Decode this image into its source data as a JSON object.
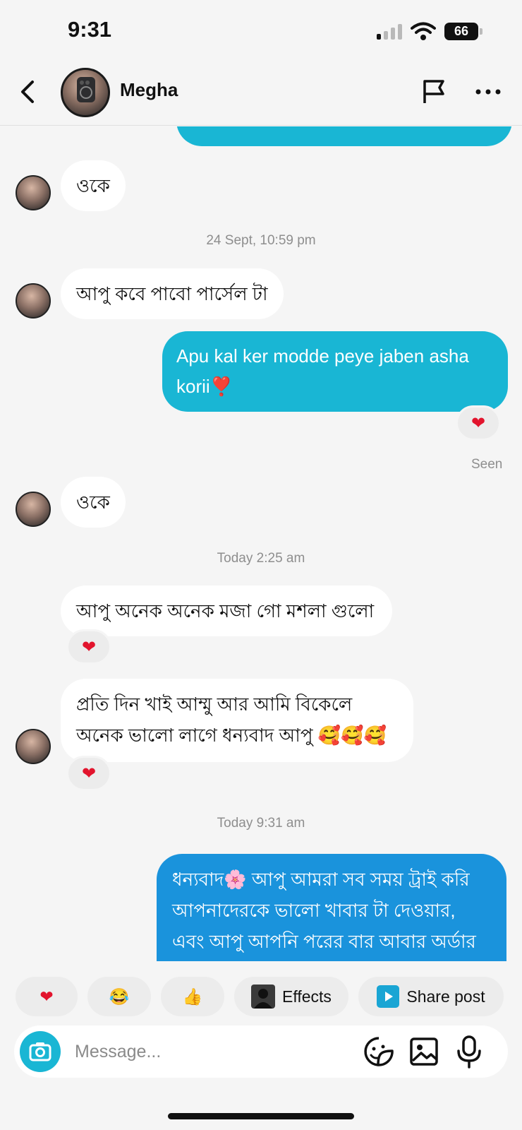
{
  "status_bar": {
    "time": "9:31",
    "battery": "66"
  },
  "header": {
    "contact_name": "Megha"
  },
  "messages": {
    "m1": {
      "text": "ওকে"
    },
    "ts1": {
      "text": "24 Sept, 10:59 pm"
    },
    "m2": {
      "text": "আপু কবে পাবো পার্সেল টা"
    },
    "m3": {
      "text": "Apu kal ker modde peye jaben asha korii❣️",
      "reaction": "❤"
    },
    "seen": {
      "text": "Seen"
    },
    "m4": {
      "text": "ওকে"
    },
    "ts2": {
      "text": "Today 2:25 am"
    },
    "m5": {
      "text": "আপু অনেক অনেক মজা গো মশলা গুলো",
      "reaction": "❤"
    },
    "m6": {
      "text": "প্রতি দিন খাই আম্মু আর আমি বিকেলে অনেক ভালো লাগে ধন্যবাদ আপু 🥰🥰🥰",
      "reaction": "❤"
    },
    "ts3": {
      "text": "Today 9:31 am"
    },
    "m7": {
      "text": "ধন্যবাদ🌸 আপু আমরা সব সময় ট্রাই করি আপনাদেরকে ভালো খাবার টা দেওয়ার, এবং আপু আপনি পরের বার আবার অর্ডার করলে"
    }
  },
  "quick_reactions": {
    "heart": "❤",
    "laugh": "😂",
    "thumbs": "👍",
    "effects_label": "Effects",
    "share_label": "Share post"
  },
  "composer": {
    "placeholder": "Message..."
  },
  "colors": {
    "outgoing": "#19b6d4",
    "outgoing_latest": "#1a93dc",
    "incoming": "#ffffff",
    "heart": "#e2142d"
  }
}
